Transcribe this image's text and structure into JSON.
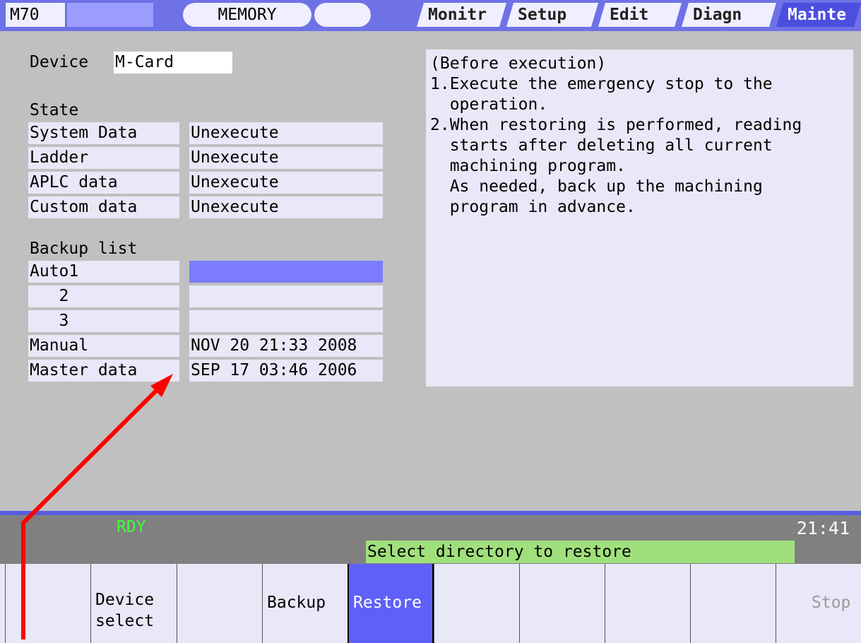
{
  "header": {
    "model": "M70",
    "mode": "MEMORY",
    "tabs": [
      {
        "label": "Monitr"
      },
      {
        "label": "Setup"
      },
      {
        "label": "Edit"
      },
      {
        "label": "Diagn"
      },
      {
        "label": "Mainte"
      }
    ]
  },
  "device": {
    "label": "Device",
    "value": "M-Card"
  },
  "state": {
    "title": "State",
    "rows": [
      {
        "name": "System Data",
        "value": "Unexecute"
      },
      {
        "name": "Ladder",
        "value": "Unexecute"
      },
      {
        "name": "APLC data",
        "value": "Unexecute"
      },
      {
        "name": "Custom data",
        "value": "Unexecute"
      }
    ]
  },
  "backup": {
    "title": "Backup list",
    "rows": [
      {
        "name": "Auto1",
        "value": ""
      },
      {
        "name": "   2",
        "value": ""
      },
      {
        "name": "   3",
        "value": ""
      },
      {
        "name": "Manual",
        "value": "NOV 20 21:33 2008"
      },
      {
        "name": "Master data",
        "value": "SEP 17 03:46 2006"
      }
    ]
  },
  "guide": {
    "lines": [
      "(Before execution)",
      "1.Execute the emergency stop to the",
      "  operation.",
      "2.When restoring is performed, reading",
      "  starts after deleting all current",
      "  machining program.",
      "  As needed, back up the machining",
      "  program in advance."
    ]
  },
  "status": {
    "ready": "RDY",
    "time": "21:41",
    "message": "Select directory to restore"
  },
  "menu": {
    "keys": [
      {
        "label": ""
      },
      {
        "label": "Device\nselect"
      },
      {
        "label": ""
      },
      {
        "label": "Backup"
      },
      {
        "label": "Restore"
      },
      {
        "label": ""
      },
      {
        "label": ""
      },
      {
        "label": ""
      },
      {
        "label": ""
      },
      {
        "label": "Stop"
      }
    ]
  },
  "colors": {
    "header_bg": "#6f71e6",
    "selected_row": "#7b7cff",
    "active_key": "#5e60f8",
    "message_bg": "#a0e07c",
    "ready_text": "#40ff40",
    "annotation_arrow": "#ff0000"
  }
}
